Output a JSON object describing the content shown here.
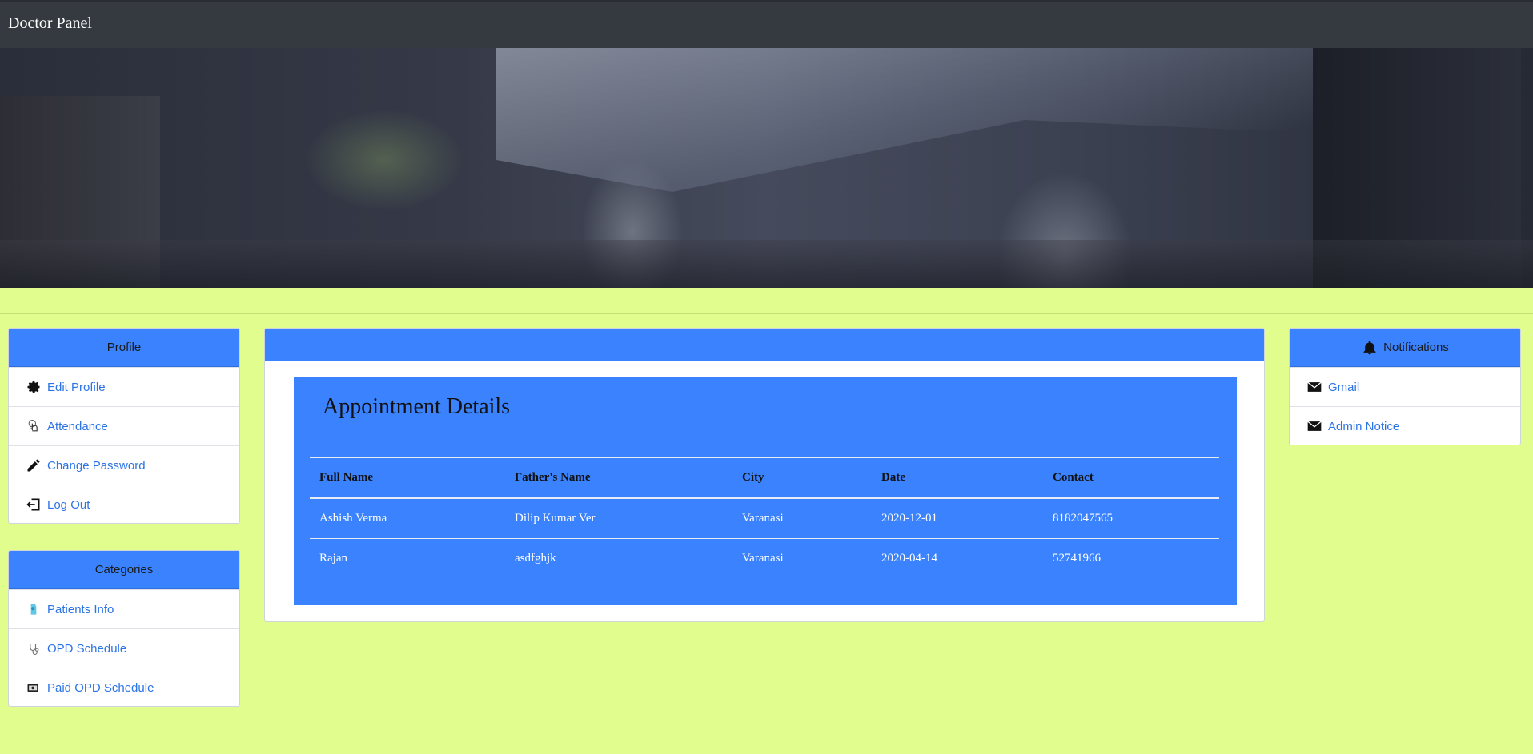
{
  "navbar": {
    "brand": "Doctor Panel"
  },
  "profile": {
    "title": "Profile",
    "items": [
      {
        "label": "Edit Profile",
        "icon": "gear-icon"
      },
      {
        "label": "Attendance",
        "icon": "hand-touch-icon"
      },
      {
        "label": "Change Password",
        "icon": "pencil-icon"
      },
      {
        "label": "Log Out",
        "icon": "logout-icon"
      }
    ]
  },
  "categories": {
    "title": "Categories",
    "items": [
      {
        "label": "Patients Info",
        "icon": "patient-icon"
      },
      {
        "label": "OPD Schedule",
        "icon": "stethoscope-icon"
      },
      {
        "label": "Paid OPD Schedule",
        "icon": "cash-icon"
      }
    ]
  },
  "appointments": {
    "title": "Appointment Details",
    "columns": [
      "Full Name",
      "Father's Name",
      "City",
      "Date",
      "Contact"
    ],
    "rows": [
      [
        "Ashish Verma",
        "Dilip Kumar Ver",
        "Varanasi",
        "2020-12-01",
        "8182047565"
      ],
      [
        "Rajan",
        "asdfghjk",
        "Varanasi",
        "2020-04-14",
        "52741966"
      ]
    ]
  },
  "notifications": {
    "title": "Notifications",
    "items": [
      {
        "label": "Gmail",
        "icon": "mail-icon"
      },
      {
        "label": "Admin Notice",
        "icon": "mail-icon"
      }
    ]
  },
  "colors": {
    "accent": "#3a82fe",
    "background": "#e0fd8d",
    "navbar": "#343a40",
    "link": "#2b73e6"
  }
}
